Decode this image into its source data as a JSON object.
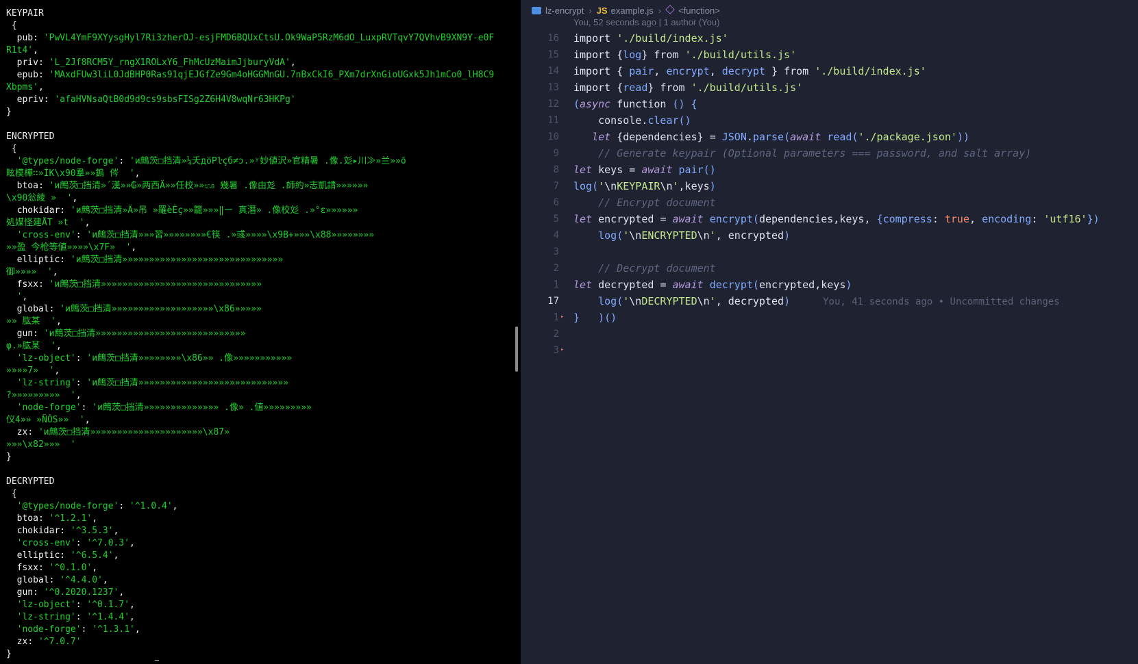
{
  "terminal": {
    "lines": [
      [
        {
          "t": "KEYPAIR",
          "c": "w"
        }
      ],
      [
        {
          "t": " {",
          "c": "w"
        }
      ],
      [
        {
          "t": "  pub: ",
          "c": "k"
        },
        {
          "t": "'PwVL4YmF9XYysgHyl7Ri3zherOJ-esjFMD6BQUxCtsU.Ok9WaP5RzM6dO_LuxpRVTqvY7QVhvB9XN9Y-e0F",
          "c": "s"
        }
      ],
      [
        {
          "t": "R1t4'",
          "c": "s"
        },
        {
          "t": ",",
          "c": "k"
        }
      ],
      [
        {
          "t": "  priv: ",
          "c": "k"
        },
        {
          "t": "'L_2Jf8RCM5Y_rngX1ROLxY6_FhMcUzMaimJjburyVdA'",
          "c": "s"
        },
        {
          "t": ",",
          "c": "k"
        }
      ],
      [
        {
          "t": "  epub: ",
          "c": "k"
        },
        {
          "t": "'MAxdFUw3liL0JdBHP0Ras91qjEJGfZe9Gm4oHGGMnGU.7nBxCkI6_PXm7drXnGioUGxk5Jh1mCo0_lH8C9",
          "c": "s"
        }
      ],
      [
        {
          "t": "Xbpms'",
          "c": "s"
        },
        {
          "t": ",",
          "c": "k"
        }
      ],
      [
        {
          "t": "  epriv: ",
          "c": "k"
        },
        {
          "t": "'afaHVNsaQtB0d9d9cs9sbsFISg2Z6H4V8wqNr63HKPg'",
          "c": "s"
        }
      ],
      [
        {
          "t": "}",
          "c": "w"
        }
      ],
      [
        {
          "t": "",
          "c": "w"
        }
      ],
      [
        {
          "t": "ENCRYPTED",
          "c": "w"
        }
      ],
      [
        {
          "t": " {",
          "c": "w"
        }
      ],
      [
        {
          "t": "  '@types/node-forge'",
          "c": "s"
        },
        {
          "t": ": ",
          "c": "k"
        },
        {
          "t": "'и鷓茨□挡清»¼夭дöPŀçб≠ɔ.»ʸ妙値沢»官精暑 .像.彣▸川≫»兰»»õ",
          "c": "s"
        }
      ],
      [
        {
          "t": "眩模樺∷»İK\\x90羣»»鎢 侺  '",
          "c": "s"
        },
        {
          "t": ",",
          "c": "k"
        }
      ],
      [
        {
          "t": "  btoa",
          "c": "k"
        },
        {
          "t": ": ",
          "c": "k"
        },
        {
          "t": "'и鷓茨□挡清»´漢»»₲»两西Ä»»任校»»ಊ 幾暑 .像由彣 .師約»志凱請»»»»»»",
          "c": "s"
        }
      ],
      [
        {
          "t": "\\x90忩綾 »  '",
          "c": "s"
        },
        {
          "t": ",",
          "c": "k"
        }
      ],
      [
        {
          "t": "  chokidar",
          "c": "k"
        },
        {
          "t": ": ",
          "c": "k"
        },
        {
          "t": "'и鷓茨□挡清»Ä»吊 »羅èÊç»»籠»»»‖ー 真潛» .像校彣 .»°ε»»»»»»",
          "c": "s"
        }
      ],
      [
        {
          "t": "処媒怪建ÅT »t  '",
          "c": "s"
        },
        {
          "t": ",",
          "c": "k"
        }
      ],
      [
        {
          "t": "  'cross-env'",
          "c": "s"
        },
        {
          "t": ": ",
          "c": "k"
        },
        {
          "t": "'и鷓茨□挡清»»»習»»»»»»»»€筷 .»彧»»»»\\x9B+»»»\\x88»»»»»»»»",
          "c": "s"
        }
      ],
      [
        {
          "t": "»»盈 今枪等値»»»»\\x7F»  '",
          "c": "s"
        },
        {
          "t": ",",
          "c": "k"
        }
      ],
      [
        {
          "t": "  elliptic",
          "c": "k"
        },
        {
          "t": ": ",
          "c": "k"
        },
        {
          "t": "'и鷓茨□挡清»»»»»»»»»»»»»»»»»»»»»»»»»»»»»»",
          "c": "s"
        }
      ],
      [
        {
          "t": "御»»»»  '",
          "c": "s"
        },
        {
          "t": ",",
          "c": "k"
        }
      ],
      [
        {
          "t": "  fsxx",
          "c": "k"
        },
        {
          "t": ": ",
          "c": "k"
        },
        {
          "t": "'и鷓茨□挡清»»»»»»»»»»»»»»»»»»»»»»»»»»»»»»",
          "c": "s"
        }
      ],
      [
        {
          "t": "  '",
          "c": "s"
        },
        {
          "t": ",",
          "c": "k"
        }
      ],
      [
        {
          "t": "  global",
          "c": "k"
        },
        {
          "t": ": ",
          "c": "k"
        },
        {
          "t": "'и鷓茨□挡清»»»»»»»»»»»»»»»»»»»\\x86»»»»»",
          "c": "s"
        }
      ],
      [
        {
          "t": "»» 肱某  '",
          "c": "s"
        },
        {
          "t": ",",
          "c": "k"
        }
      ],
      [
        {
          "t": "  gun",
          "c": "k"
        },
        {
          "t": ": ",
          "c": "k"
        },
        {
          "t": "'и鷓茨□挡清»»»»»»»»»»»»»»»»»»»»»»»»»»»»",
          "c": "s"
        }
      ],
      [
        {
          "t": "φ.»肱某  '",
          "c": "s"
        },
        {
          "t": ",",
          "c": "k"
        }
      ],
      [
        {
          "t": "  'lz-object'",
          "c": "s"
        },
        {
          "t": ": ",
          "c": "k"
        },
        {
          "t": "'и鷓茨□挡清»»»»»»»»\\x86»» .像»»»»»»»»»»»",
          "c": "s"
        }
      ],
      [
        {
          "t": "»»»»7»  '",
          "c": "s"
        },
        {
          "t": ",",
          "c": "k"
        }
      ],
      [
        {
          "t": "  'lz-string'",
          "c": "s"
        },
        {
          "t": ": ",
          "c": "k"
        },
        {
          "t": "'и鷓茨□挡清»»»»»»»»»»»»»»»»»»»»»»»»»»»»",
          "c": "s"
        }
      ],
      [
        {
          "t": "?»»»»»»»»»  '",
          "c": "s"
        },
        {
          "t": ",",
          "c": "k"
        }
      ],
      [
        {
          "t": "  'node-forge'",
          "c": "s"
        },
        {
          "t": ": ",
          "c": "k"
        },
        {
          "t": "'и鷓茨□挡清»»»»»»»»»»»»»» .像» .値»»»»»»»»»",
          "c": "s"
        }
      ],
      [
        {
          "t": "仪4»» »ÑÒS»»  '",
          "c": "s"
        },
        {
          "t": ",",
          "c": "k"
        }
      ],
      [
        {
          "t": "  zx",
          "c": "k"
        },
        {
          "t": ": ",
          "c": "k"
        },
        {
          "t": "'и鷓茨□挡清»»»»»»»»»»»»»»»»»»»»»\\x87»",
          "c": "s"
        }
      ],
      [
        {
          "t": "»»»\\x82»»»  '",
          "c": "s"
        }
      ],
      [
        {
          "t": "}",
          "c": "w"
        }
      ],
      [
        {
          "t": "",
          "c": "w"
        }
      ],
      [
        {
          "t": "DECRYPTED",
          "c": "w"
        }
      ],
      [
        {
          "t": " {",
          "c": "w"
        }
      ],
      [
        {
          "t": "  '@types/node-forge'",
          "c": "s"
        },
        {
          "t": ": ",
          "c": "k"
        },
        {
          "t": "'^1.0.4'",
          "c": "s"
        },
        {
          "t": ",",
          "c": "k"
        }
      ],
      [
        {
          "t": "  btoa",
          "c": "k"
        },
        {
          "t": ": ",
          "c": "k"
        },
        {
          "t": "'^1.2.1'",
          "c": "s"
        },
        {
          "t": ",",
          "c": "k"
        }
      ],
      [
        {
          "t": "  chokidar",
          "c": "k"
        },
        {
          "t": ": ",
          "c": "k"
        },
        {
          "t": "'^3.5.3'",
          "c": "s"
        },
        {
          "t": ",",
          "c": "k"
        }
      ],
      [
        {
          "t": "  'cross-env'",
          "c": "s"
        },
        {
          "t": ": ",
          "c": "k"
        },
        {
          "t": "'^7.0.3'",
          "c": "s"
        },
        {
          "t": ",",
          "c": "k"
        }
      ],
      [
        {
          "t": "  elliptic",
          "c": "k"
        },
        {
          "t": ": ",
          "c": "k"
        },
        {
          "t": "'^6.5.4'",
          "c": "s"
        },
        {
          "t": ",",
          "c": "k"
        }
      ],
      [
        {
          "t": "  fsxx",
          "c": "k"
        },
        {
          "t": ": ",
          "c": "k"
        },
        {
          "t": "'^0.1.0'",
          "c": "s"
        },
        {
          "t": ",",
          "c": "k"
        }
      ],
      [
        {
          "t": "  global",
          "c": "k"
        },
        {
          "t": ": ",
          "c": "k"
        },
        {
          "t": "'^4.4.0'",
          "c": "s"
        },
        {
          "t": ",",
          "c": "k"
        }
      ],
      [
        {
          "t": "  gun",
          "c": "k"
        },
        {
          "t": ": ",
          "c": "k"
        },
        {
          "t": "'^0.2020.1237'",
          "c": "s"
        },
        {
          "t": ",",
          "c": "k"
        }
      ],
      [
        {
          "t": "  'lz-object'",
          "c": "s"
        },
        {
          "t": ": ",
          "c": "k"
        },
        {
          "t": "'^0.1.7'",
          "c": "s"
        },
        {
          "t": ",",
          "c": "k"
        }
      ],
      [
        {
          "t": "  'lz-string'",
          "c": "s"
        },
        {
          "t": ": ",
          "c": "k"
        },
        {
          "t": "'^1.4.4'",
          "c": "s"
        },
        {
          "t": ",",
          "c": "k"
        }
      ],
      [
        {
          "t": "  'node-forge'",
          "c": "s"
        },
        {
          "t": ": ",
          "c": "k"
        },
        {
          "t": "'^1.3.1'",
          "c": "s"
        },
        {
          "t": ",",
          "c": "k"
        }
      ],
      [
        {
          "t": "  zx",
          "c": "k"
        },
        {
          "t": ": ",
          "c": "k"
        },
        {
          "t": "'^7.0.7'",
          "c": "s"
        }
      ],
      [
        {
          "t": "}",
          "c": "w"
        }
      ]
    ]
  },
  "editor": {
    "breadcrumb": {
      "folder": "lz-encrypt",
      "file_badge": "JS",
      "file": "example.js",
      "symbol": "<function>",
      "folder_icon": "folder-icon",
      "symbol_icon": "cube-icon"
    },
    "codelens": "You, 52 seconds ago | 1 author (You)",
    "line_numbers": [
      "16",
      "15",
      "14",
      "13",
      "12",
      "11",
      "10",
      "9",
      "8",
      "7",
      "6",
      "5",
      "4",
      "3",
      "2",
      "1",
      "17",
      "1",
      "2",
      "3"
    ],
    "current_line_index": 16,
    "blame": "You, 41 seconds ago • Uncommitted changes",
    "code": [
      [
        {
          "t": "import ",
          "c": "kw"
        },
        {
          "t": "'./build/index.js'",
          "c": "str"
        }
      ],
      [
        {
          "t": "import ",
          "c": "kw"
        },
        {
          "t": "{",
          "c": "kw"
        },
        {
          "t": "log",
          "c": "var"
        },
        {
          "t": "} ",
          "c": "kw"
        },
        {
          "t": "from ",
          "c": "kw"
        },
        {
          "t": "'./build/utils.js'",
          "c": "str"
        }
      ],
      [
        {
          "t": "import ",
          "c": "kw"
        },
        {
          "t": "{ ",
          "c": "kw"
        },
        {
          "t": "pair",
          "c": "var"
        },
        {
          "t": ", ",
          "c": "kw"
        },
        {
          "t": "encrypt",
          "c": "var"
        },
        {
          "t": ", ",
          "c": "kw"
        },
        {
          "t": "decrypt",
          "c": "var"
        },
        {
          "t": " } ",
          "c": "kw"
        },
        {
          "t": "from ",
          "c": "kw"
        },
        {
          "t": "'./build/index.js'",
          "c": "str"
        }
      ],
      [
        {
          "t": "import ",
          "c": "kw"
        },
        {
          "t": "{",
          "c": "kw"
        },
        {
          "t": "read",
          "c": "var"
        },
        {
          "t": "} ",
          "c": "kw"
        },
        {
          "t": "from ",
          "c": "kw"
        },
        {
          "t": "'./build/utils.js'",
          "c": "str"
        }
      ],
      [
        {
          "t": "(",
          "c": "var"
        },
        {
          "t": "async ",
          "c": "it"
        },
        {
          "t": "function ",
          "c": "kw"
        },
        {
          "t": "() {",
          "c": "var"
        }
      ],
      [
        {
          "t": "    console.",
          "c": "kw"
        },
        {
          "t": "clear",
          "c": "var"
        },
        {
          "t": "()",
          "c": "var"
        }
      ],
      [
        {
          "t": "   ",
          "c": "kw"
        },
        {
          "t": "let ",
          "c": "it"
        },
        {
          "t": "{dependencies} ",
          "c": "kw"
        },
        {
          "t": "= ",
          "c": "kw"
        },
        {
          "t": "JSON",
          "c": "var"
        },
        {
          "t": ".",
          "c": "kw"
        },
        {
          "t": "parse",
          "c": "var"
        },
        {
          "t": "(",
          "c": "var"
        },
        {
          "t": "await ",
          "c": "it"
        },
        {
          "t": "read",
          "c": "var"
        },
        {
          "t": "(",
          "c": "var"
        },
        {
          "t": "'./package.json'",
          "c": "str"
        },
        {
          "t": "))",
          "c": "var"
        }
      ],
      [
        {
          "t": "    // Generate keypair (Optional parameters === password, and salt array)",
          "c": "cm"
        }
      ],
      [
        {
          "t": "let ",
          "c": "it"
        },
        {
          "t": "keys ",
          "c": "kw"
        },
        {
          "t": "= ",
          "c": "kw"
        },
        {
          "t": "await ",
          "c": "it"
        },
        {
          "t": "pair",
          "c": "var"
        },
        {
          "t": "()",
          "c": "var"
        }
      ],
      [
        {
          "t": "log",
          "c": "var"
        },
        {
          "t": "(",
          "c": "var"
        },
        {
          "t": "'",
          "c": "str"
        },
        {
          "t": "\\n",
          "c": "esc"
        },
        {
          "t": "KEYPAIR",
          "c": "grn"
        },
        {
          "t": "\\n",
          "c": "esc"
        },
        {
          "t": "'",
          "c": "str"
        },
        {
          "t": ",keys",
          "c": "kw"
        },
        {
          "t": ")",
          "c": "var"
        }
      ],
      [
        {
          "t": "    // Encrypt document",
          "c": "cm"
        }
      ],
      [
        {
          "t": "let ",
          "c": "it"
        },
        {
          "t": "encrypted ",
          "c": "kw"
        },
        {
          "t": "= ",
          "c": "kw"
        },
        {
          "t": "await ",
          "c": "it"
        },
        {
          "t": "encrypt",
          "c": "var"
        },
        {
          "t": "(",
          "c": "var"
        },
        {
          "t": "dependencies,keys, ",
          "c": "kw"
        },
        {
          "t": "{",
          "c": "var"
        },
        {
          "t": "compress",
          "c": "var"
        },
        {
          "t": ": ",
          "c": "kw"
        },
        {
          "t": "true",
          "c": "bool"
        },
        {
          "t": ", ",
          "c": "kw"
        },
        {
          "t": "encoding",
          "c": "var"
        },
        {
          "t": ": ",
          "c": "kw"
        },
        {
          "t": "'utf16'",
          "c": "str"
        },
        {
          "t": "})",
          "c": "var"
        }
      ],
      [
        {
          "t": "    ",
          "c": "kw"
        },
        {
          "t": "log",
          "c": "var"
        },
        {
          "t": "(",
          "c": "var"
        },
        {
          "t": "'",
          "c": "str"
        },
        {
          "t": "\\n",
          "c": "esc"
        },
        {
          "t": "ENCRYPTED",
          "c": "grn"
        },
        {
          "t": "\\n",
          "c": "esc"
        },
        {
          "t": "'",
          "c": "str"
        },
        {
          "t": ", encrypted",
          "c": "kw"
        },
        {
          "t": ")",
          "c": "var"
        }
      ],
      [
        {
          "t": "",
          "c": "kw"
        }
      ],
      [
        {
          "t": "    // Decrypt document",
          "c": "cm"
        }
      ],
      [
        {
          "t": "let ",
          "c": "it"
        },
        {
          "t": "decrypted ",
          "c": "kw"
        },
        {
          "t": "= ",
          "c": "kw"
        },
        {
          "t": "await ",
          "c": "it"
        },
        {
          "t": "decrypt",
          "c": "var"
        },
        {
          "t": "(",
          "c": "var"
        },
        {
          "t": "encrypted,keys",
          "c": "kw"
        },
        {
          "t": ")",
          "c": "var"
        }
      ],
      [
        {
          "t": "    ",
          "c": "kw"
        },
        {
          "t": "log",
          "c": "var"
        },
        {
          "t": "(",
          "c": "var"
        },
        {
          "t": "'",
          "c": "str"
        },
        {
          "t": "\\n",
          "c": "esc"
        },
        {
          "t": "DECRYPTED",
          "c": "grn"
        },
        {
          "t": "\\n",
          "c": "esc"
        },
        {
          "t": "'",
          "c": "str"
        },
        {
          "t": ", decrypted",
          "c": "kw"
        },
        {
          "t": ")",
          "c": "var"
        }
      ],
      [
        {
          "t": "}   ",
          "c": "var"
        },
        {
          "t": ")()",
          "c": "var"
        }
      ],
      [
        {
          "t": "",
          "c": "kw"
        }
      ],
      [
        {
          "t": "",
          "c": "kw"
        }
      ]
    ],
    "git_marker_lines": [
      17,
      19
    ]
  }
}
